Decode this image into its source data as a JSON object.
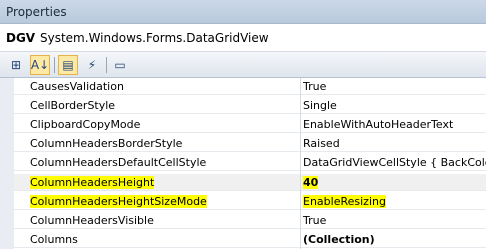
{
  "window": {
    "title": "Properties"
  },
  "object_selector": {
    "name": "DGV",
    "type": "System.Windows.Forms.DataGridView"
  },
  "toolbar": {
    "buttons": [
      {
        "icon": "categorized-icon",
        "glyph": "⊞"
      },
      {
        "icon": "alphabetical-sort-icon",
        "glyph": "A↓"
      },
      {
        "icon": "properties-icon",
        "glyph": "▤"
      },
      {
        "icon": "events-lightning-icon",
        "glyph": "⚡"
      },
      {
        "icon": "property-pages-icon",
        "glyph": "▭"
      }
    ]
  },
  "properties": [
    {
      "name": "CausesValidation",
      "value": "True"
    },
    {
      "name": "CellBorderStyle",
      "value": "Single"
    },
    {
      "name": "ClipboardCopyMode",
      "value": "EnableWithAutoHeaderText"
    },
    {
      "name": "ColumnHeadersBorderStyle",
      "value": "Raised"
    },
    {
      "name": "ColumnHeadersDefaultCellStyle",
      "value": "DataGridViewCellStyle { BackColor="
    },
    {
      "name": "ColumnHeadersHeight",
      "value": "40"
    },
    {
      "name": "ColumnHeadersHeightSizeMode",
      "value": "EnableResizing"
    },
    {
      "name": "ColumnHeadersVisible",
      "value": "True"
    },
    {
      "name": "Columns",
      "value": "(Collection)"
    }
  ],
  "colors": {
    "highlight": "#ffff00",
    "titlebar": "#c6d3e5"
  }
}
